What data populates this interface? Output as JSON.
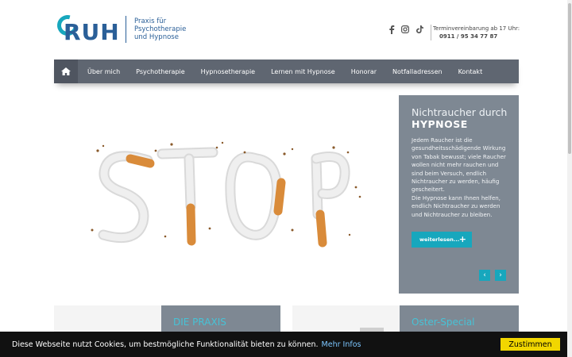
{
  "logo": {
    "letters": "RUH",
    "line1": "Praxis für",
    "line2": "Psychotherapie",
    "line3": "und Hypnose"
  },
  "header": {
    "social_icons": [
      "facebook-icon",
      "instagram-icon",
      "tiktok-icon"
    ],
    "appointment_label": "Terminvereinbarung ab 17 Uhr:",
    "phone": "0911 / 95 34 77 87"
  },
  "nav": {
    "items": [
      "Über mich",
      "Psychotherapie",
      "Hypnosetherapie",
      "Lernen mit Hypnose",
      "Honorar",
      "Notfalladressen",
      "Kontakt"
    ]
  },
  "slider": {
    "title_light": "Nichtraucher durch",
    "title_bold": "HYPNOSE",
    "paragraph1": "Jedem Raucher ist die gesundheitsschädigende Wirkung von Tabak bewusst; viele Raucher wollen nicht mehr rauchen und sind beim Versuch, endlich Nichtraucher zu werden, häufig gescheitert.",
    "paragraph2": "Die Hypnose kann Ihnen helfen, endlich Nichtraucher zu werden und Nichtraucher zu bleiben.",
    "read_more": "weiterlesen..."
  },
  "cards": [
    {
      "title": "DIE PRAXIS"
    },
    {
      "title": "Oster-Special"
    }
  ],
  "cookie": {
    "text": "Diese Webseite nutzt Cookies, um bestmögliche Funktionalität bieten zu können.",
    "link": "Mehr Infos",
    "button": "Zustimmen"
  },
  "colors": {
    "accent": "#17a7bd",
    "brand": "#2a5f98",
    "nav": "#5f6671",
    "panel": "#7e8893",
    "cookie_button": "#f1d600"
  }
}
